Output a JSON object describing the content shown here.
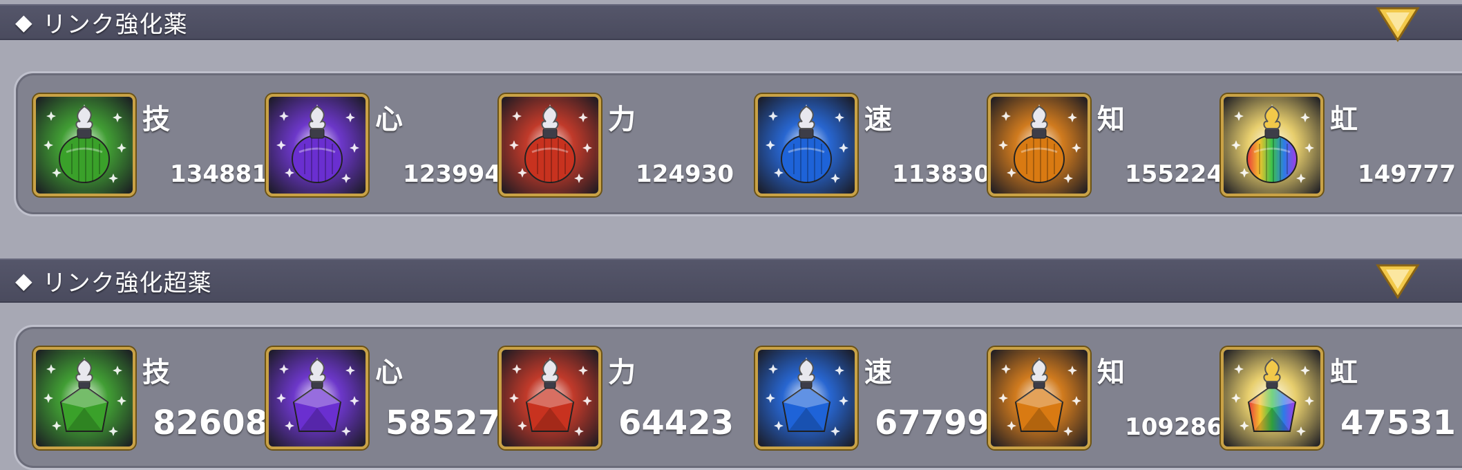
{
  "sections": [
    {
      "title": "リンク強化薬",
      "items": [
        {
          "attr": "技",
          "count": "134881",
          "color": "#3aa12a"
        },
        {
          "attr": "心",
          "count": "123994",
          "color": "#6a2fd0"
        },
        {
          "attr": "力",
          "count": "124930",
          "color": "#c8321f"
        },
        {
          "attr": "速",
          "count": "113830",
          "color": "#1e63d8"
        },
        {
          "attr": "知",
          "count": "155224",
          "color": "#d97a12"
        },
        {
          "attr": "虹",
          "count": "149777",
          "color": "#c94fd6"
        }
      ]
    },
    {
      "title": "リンク強化超薬",
      "items": [
        {
          "attr": "技",
          "count": "82608",
          "color": "#3aa12a"
        },
        {
          "attr": "心",
          "count": "58527",
          "color": "#6a2fd0"
        },
        {
          "attr": "力",
          "count": "64423",
          "color": "#c8321f"
        },
        {
          "attr": "速",
          "count": "67799",
          "color": "#1e63d8"
        },
        {
          "attr": "知",
          "count": "109286",
          "color": "#d97a12"
        },
        {
          "attr": "虹",
          "count": "47531",
          "color": "#c94fd6"
        }
      ]
    }
  ],
  "icons": {
    "diamond": "◆",
    "toggle": "chevron-down-icon",
    "potion": "potion-icon",
    "super_potion": "super-potion-icon"
  },
  "colors": {
    "header_bg": "#4f5064",
    "panel_bg": "#81828f",
    "page_bg": "#a7a8b4",
    "gold": "#c9a246",
    "rainbow": [
      "#e83a3a",
      "#f2c22e",
      "#3ac24a",
      "#2e7ae8",
      "#a43ae8"
    ]
  }
}
